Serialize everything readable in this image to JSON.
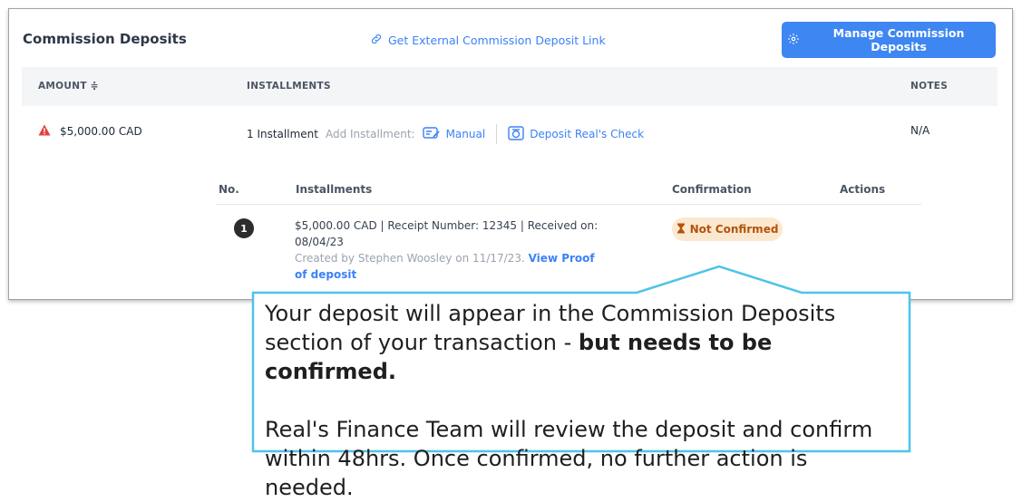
{
  "panel": {
    "title": "Commission Deposits",
    "external_link": "Get External Commission Deposit Link",
    "manage_button": "Manage Commission Deposits"
  },
  "table": {
    "headers": {
      "amount": "AMOUNT ≑",
      "installments": "INSTALLMENTS",
      "notes": "NOTES"
    },
    "row": {
      "amount": "$5,000.00 CAD",
      "installments_count": "1 Installment",
      "add_label": "Add Installment:",
      "manual": "Manual",
      "deposit_check": "Deposit Real's Check",
      "notes": "N/A"
    }
  },
  "subtable": {
    "headers": {
      "no": "No.",
      "installments": "Installments",
      "confirmation": "Confirmation",
      "actions": "Actions"
    },
    "row": {
      "number": "1",
      "line1": "$5,000.00 CAD | Receipt Number: 12345 | Received on: 08/04/23",
      "created": "Created by Stephen Woosley on 11/17/23.",
      "proof_link": "View Proof of deposit",
      "status": "Not Confirmed"
    }
  },
  "callout": {
    "line1": "Your deposit will appear in the Commission Deposits section of your transaction - ",
    "line1_bold": "but needs to be confirmed.",
    "line2": "Real's Finance Team will review the deposit and confirm within 48hrs. Once confirmed, no further action is needed."
  },
  "colors": {
    "accent": "#3e86f2",
    "callout_border": "#4fc3e8",
    "warning": "#e53e3e",
    "status_bg": "#fbe8d0",
    "status_text": "#b45309"
  },
  "icons": {
    "external_link": "link-icon",
    "manage": "gear-icon",
    "warning": "warning-triangle-icon",
    "manual": "manual-entry-icon",
    "check": "check-deposit-icon",
    "status": "hourglass-icon"
  }
}
